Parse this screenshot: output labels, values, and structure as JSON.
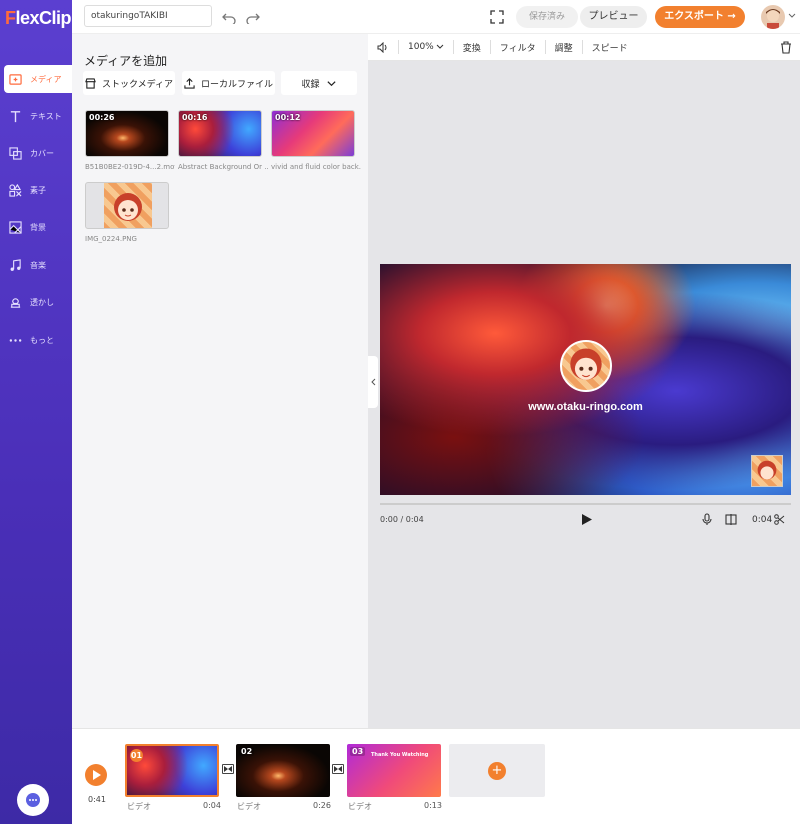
{
  "app": {
    "logo": "FlexClip",
    "project_name": "otakuringoTAKIBI"
  },
  "header": {
    "saved_label": "保存済み",
    "preview_label": "プレビュー",
    "export_label": "エクスポート"
  },
  "sidebar": {
    "items": [
      {
        "label": "メディア",
        "icon": "media-icon",
        "active": true
      },
      {
        "label": "テキスト",
        "icon": "text-icon"
      },
      {
        "label": "カバー",
        "icon": "cover-icon"
      },
      {
        "label": "素子",
        "icon": "elements-icon"
      },
      {
        "label": "背景",
        "icon": "background-icon"
      },
      {
        "label": "音楽",
        "icon": "music-icon"
      },
      {
        "label": "透かし",
        "icon": "watermark-icon"
      },
      {
        "label": "もっと",
        "icon": "more-icon"
      }
    ]
  },
  "media_panel": {
    "title": "メディアを追加",
    "stock_label": "ストックメディア",
    "local_label": "ローカルファイル",
    "collect_label": "収録",
    "items": [
      {
        "duration": "00:26",
        "name": "B51B0BE2-019D-4...2.mov"
      },
      {
        "duration": "00:16",
        "name": "Abstract Background Or ..."
      },
      {
        "duration": "00:12",
        "name": "vivid and fluid color back..."
      },
      {
        "duration": "",
        "name": "IMG_0224.PNG"
      }
    ]
  },
  "toolbar": {
    "volume": "100%",
    "transform": "変換",
    "filter": "フィルタ",
    "adjust": "調整",
    "speed": "スピード"
  },
  "preview": {
    "url_text": "www.otaku-ringo.com",
    "time_current": "0:00 / 0:04",
    "clip_length": "0:04"
  },
  "timeline": {
    "total": "0:41",
    "clips": [
      {
        "num": "01",
        "label": "ビデオ",
        "duration": "0:04"
      },
      {
        "num": "02",
        "label": "ビデオ",
        "duration": "0:26"
      },
      {
        "num": "03",
        "label": "ビデオ",
        "duration": "0:13",
        "overlay": "Thank You Watching"
      }
    ]
  },
  "colors": {
    "accent": "#f2802e",
    "sidebar": "#4a2fb8"
  }
}
